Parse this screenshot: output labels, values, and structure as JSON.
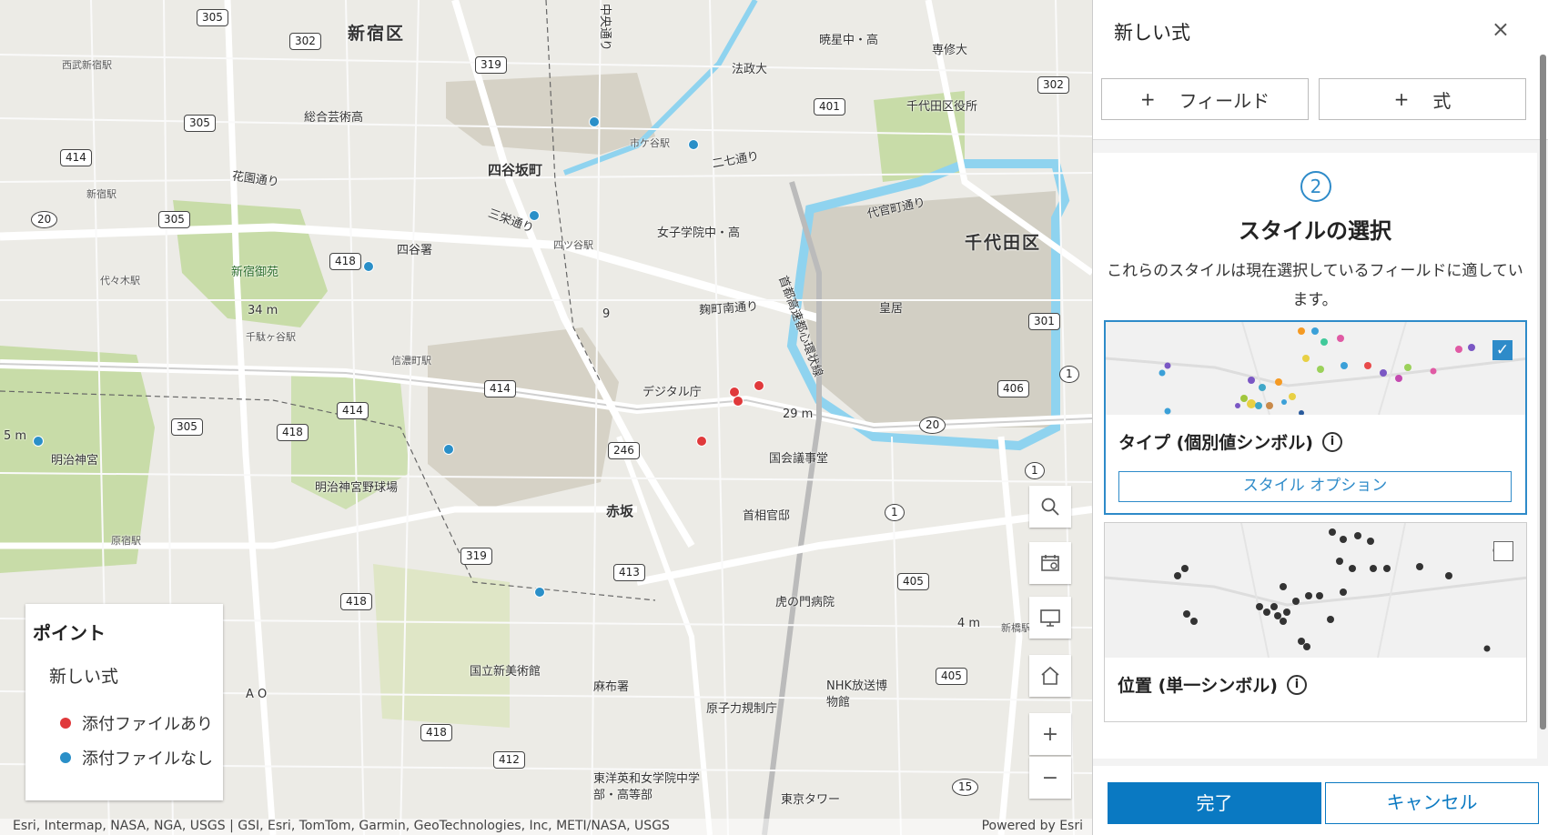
{
  "map": {
    "areas": {
      "shinjuku_ku": "新宿区",
      "chiyoda_ku": "千代田区",
      "yotsuya": "四谷坂町",
      "akasaka": "赤坂"
    },
    "labels": {
      "nishi_shinjuku": "西武新宿駅",
      "sogo_geijutsu": "総合芸術高",
      "kaen_dori": "花園通り",
      "shinjuku_eki": "新宿駅",
      "yoyogi": "代々木駅",
      "shinjuku_gyoen": "新宿御苑",
      "sendagaya": "千駄ヶ谷駅",
      "meiji_jingu": "明治神宮",
      "harajuku": "原宿駅",
      "yotsuya_sho": "四谷署",
      "shinanomachi": "信濃町駅",
      "meiji_stadium": "明治神宮野球場",
      "ichigaya": "市ケ谷駅",
      "sanei": "三栄通り",
      "yotsuya_eki": "四ツ谷駅",
      "hosei": "法政大",
      "gyosei": "暁星中・高",
      "senshu": "専修大",
      "chiyoda_office": "千代田区役所",
      "nishichi": "二七通り",
      "joshi": "女子学院中・高",
      "kojimachi": "麹町南通り",
      "digital": "デジタル庁",
      "kokkai": "国会議事堂",
      "kantei": "首相官邸",
      "kokyo": "皇居",
      "daikanmachi": "代官町通り",
      "shutoko": "首都高速都心環状線",
      "toranomon": "虎の門病院",
      "kokuritsu": "国立新美術館",
      "azabu": "麻布署",
      "genshiryoku": "原子力規制庁",
      "nhk": "NHK放送博物館",
      "toyo": "東洋英和女学院中学部・高等部",
      "tokyo_tower": "東京タワー",
      "shinbashi": "新橋駅",
      "chuo": "中央通り",
      "elev1": "34 m",
      "elev2": "29 m",
      "elev3": "4 m",
      "elev4": "5 m",
      "ao": "A O",
      "num9": "9"
    },
    "attribution": "Esri, Intermap, NASA, NGA, USGS | GSI, Esri, TomTom, Garmin, GeoTechnologies, Inc, METI/NASA, USGS",
    "powered": "Powered by Esri"
  },
  "legend": {
    "title": "ポイント",
    "field": "新しい式",
    "items": [
      {
        "label": "添付ファイルあり",
        "color": "#e0393b"
      },
      {
        "label": "添付ファイルなし",
        "color": "#2a8fc8"
      }
    ]
  },
  "widgets": {
    "search": "search-icon",
    "basemap": "basemap-icon",
    "screen": "monitor-icon",
    "home": "home-icon",
    "zoom_in": "+",
    "zoom_out": "−"
  },
  "panel": {
    "title": "新しい式",
    "close": "×",
    "add_field": "フィールド",
    "add_expression": "式",
    "plus": "+",
    "step": "2",
    "section_title": "スタイルの選択",
    "section_desc": "これらのスタイルは現在選択しているフィールドに適しています。",
    "styles": [
      {
        "name": "タイプ (個別値シンボル)",
        "selected": true,
        "options_label": "スタイル オプション"
      },
      {
        "name": "位置 (単一シンボル)",
        "selected": false
      }
    ],
    "done": "完了",
    "cancel": "キャンセル"
  }
}
